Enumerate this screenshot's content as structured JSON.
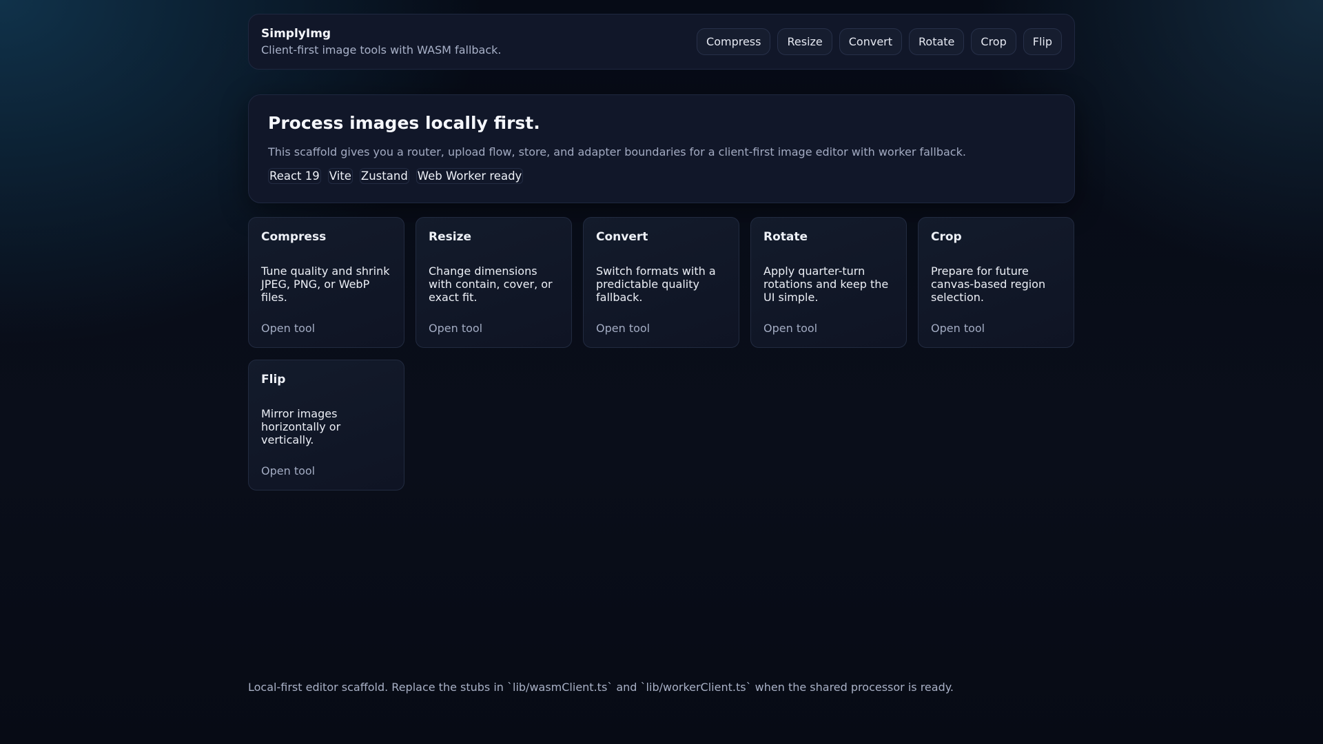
{
  "header": {
    "title": "SimplyImg",
    "subtitle": "Client-first image tools with WASM fallback.",
    "nav": [
      "Compress",
      "Resize",
      "Convert",
      "Rotate",
      "Crop",
      "Flip"
    ]
  },
  "hero": {
    "title": "Process images locally first.",
    "description": "This scaffold gives you a router, upload flow, store, and adapter boundaries for a client-first image editor with worker fallback.",
    "tags": [
      "React 19",
      "Vite",
      "Zustand",
      "Web Worker ready"
    ]
  },
  "tools": [
    {
      "name": "Compress",
      "description": "Tune quality and shrink JPEG, PNG, or WebP files.",
      "link": "Open tool"
    },
    {
      "name": "Resize",
      "description": "Change dimensions with contain, cover, or exact fit.",
      "link": "Open tool"
    },
    {
      "name": "Convert",
      "description": "Switch formats with a predictable quality fallback.",
      "link": "Open tool"
    },
    {
      "name": "Rotate",
      "description": "Apply quarter-turn rotations and keep the UI simple.",
      "link": "Open tool"
    },
    {
      "name": "Crop",
      "description": "Prepare for future canvas-based region selection.",
      "link": "Open tool"
    },
    {
      "name": "Flip",
      "description": "Mirror images horizontally or vertically.",
      "link": "Open tool"
    }
  ],
  "footer": "Local-first editor scaffold. Replace the stubs in `lib/wasmClient.ts` and `lib/workerClient.ts` when the shared processor is ready."
}
